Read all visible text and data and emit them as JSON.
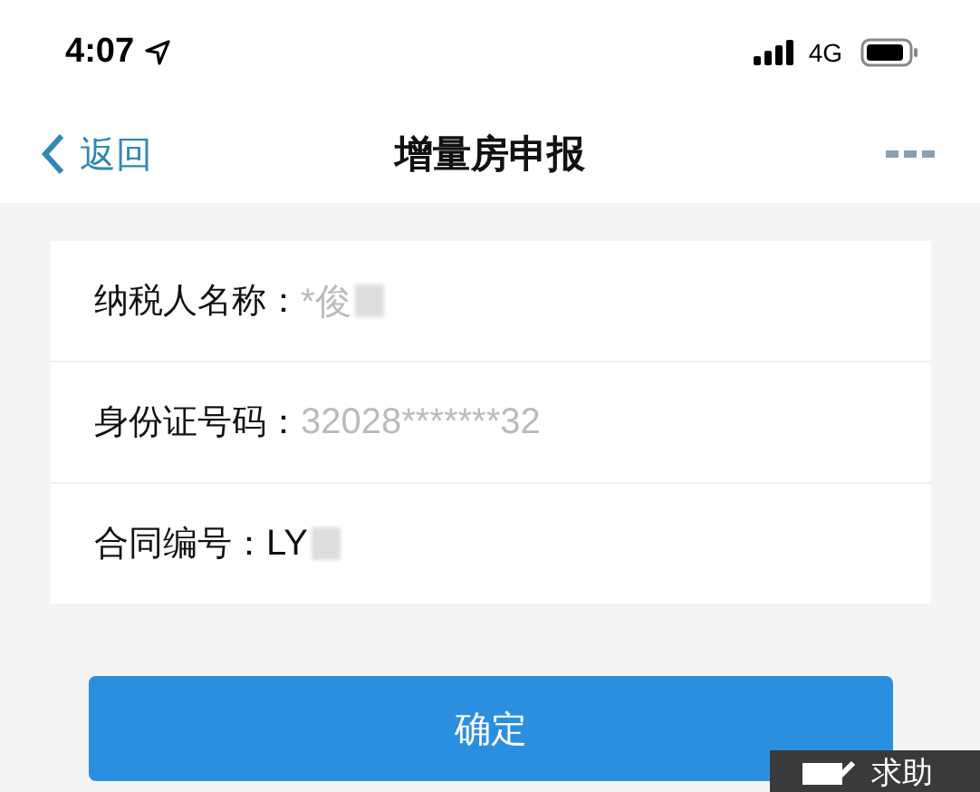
{
  "status_bar": {
    "time": "4:07",
    "network": "4G"
  },
  "nav": {
    "back": "返回",
    "title": "增量房申报"
  },
  "fields": [
    {
      "label": "纳税人名称：",
      "value": "*俊",
      "redacted": true,
      "muted": true
    },
    {
      "label": "身份证号码：",
      "value": "32028*******32",
      "redacted": false,
      "muted": true
    },
    {
      "label": "合同编号：",
      "value": "LY",
      "redacted": true,
      "muted": false
    }
  ],
  "confirm_button": "确定",
  "help_button": "求助"
}
